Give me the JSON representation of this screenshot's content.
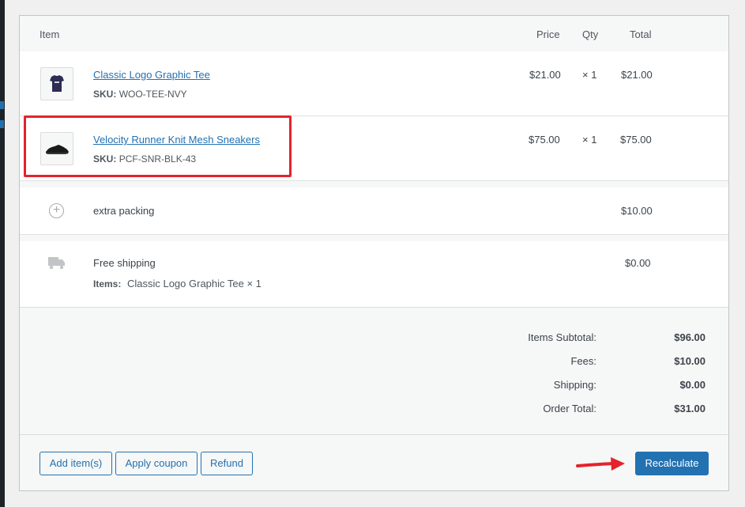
{
  "table_header": {
    "item": "Item",
    "price": "Price",
    "qty": "Qty",
    "total": "Total"
  },
  "line_items": [
    {
      "name": "Classic Logo Graphic Tee",
      "sku_label": "SKU:",
      "sku": "WOO-TEE-NVY",
      "price": "$21.00",
      "qty": "× 1",
      "total": "$21.00",
      "thumb_icon": "tshirt-icon"
    },
    {
      "name": "Velocity Runner Knit Mesh Sneakers",
      "sku_label": "SKU:",
      "sku": "PCF-SNR-BLK-43",
      "price": "$75.00",
      "qty": "× 1",
      "total": "$75.00",
      "thumb_icon": "sneaker-icon"
    }
  ],
  "fee": {
    "name": "extra packing",
    "total": "$10.00",
    "icon": "plus-circle-icon"
  },
  "shipping": {
    "name": "Free shipping",
    "items_label": "Items:",
    "items": "Classic Logo Graphic Tee × 1",
    "total": "$0.00",
    "icon": "truck-icon"
  },
  "totals": {
    "items_subtotal_label": "Items Subtotal:",
    "items_subtotal": "$96.00",
    "fees_label": "Fees:",
    "fees": "$10.00",
    "shipping_label": "Shipping:",
    "shipping": "$0.00",
    "order_total_label": "Order Total:",
    "order_total": "$31.00"
  },
  "actions": {
    "add_items": "Add item(s)",
    "apply_coupon": "Apply coupon",
    "refund": "Refund",
    "recalculate": "Recalculate"
  },
  "colors": {
    "accent": "#2271b1",
    "highlight": "#e3242b"
  }
}
